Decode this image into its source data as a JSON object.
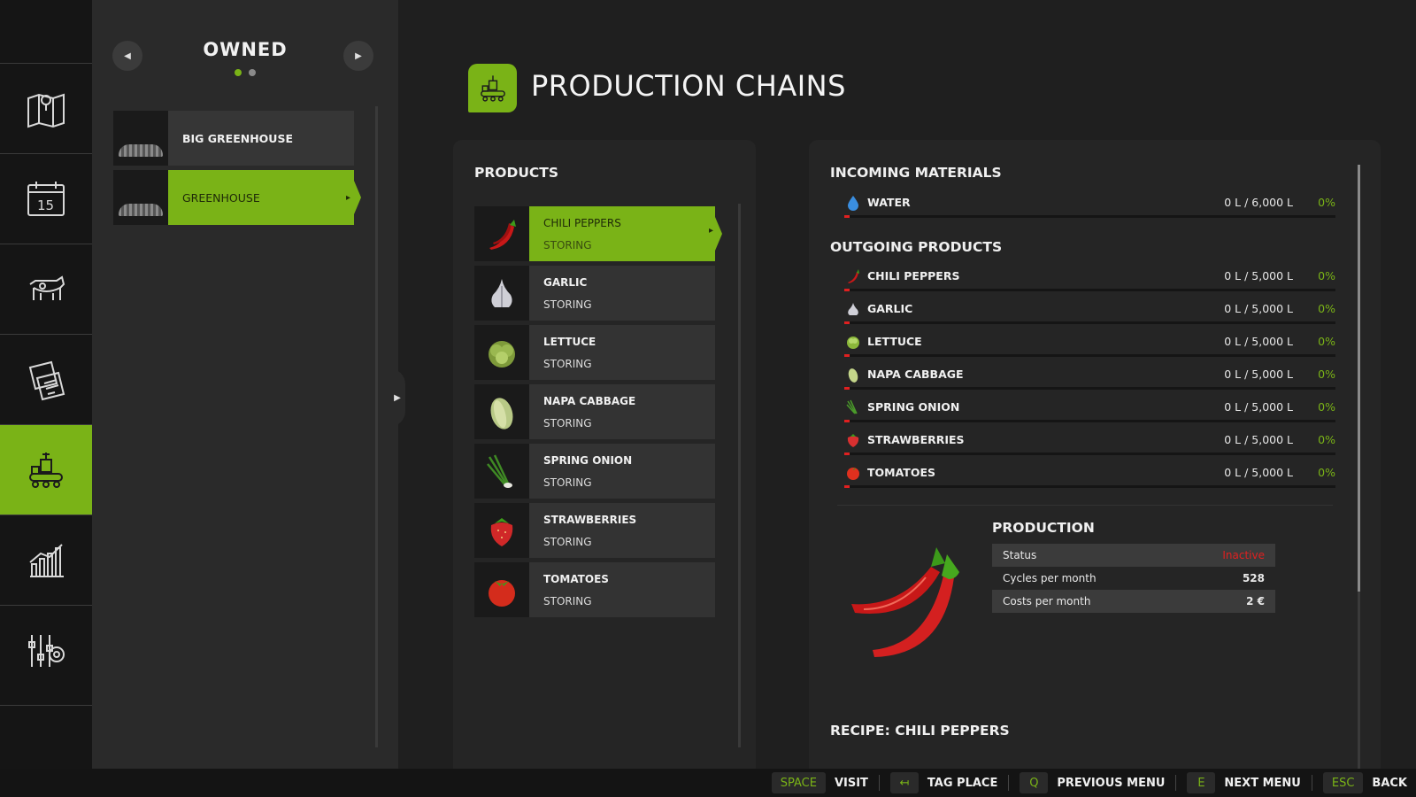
{
  "owned": {
    "title": "OWNED",
    "places": [
      {
        "label": "BIG GREENHOUSE"
      },
      {
        "label": "GREENHOUSE"
      }
    ]
  },
  "page": {
    "title": "PRODUCTION CHAINS"
  },
  "products": {
    "title": "PRODUCTS",
    "items": [
      {
        "name": "CHILI PEPPERS",
        "status": "STORING"
      },
      {
        "name": "GARLIC",
        "status": "STORING"
      },
      {
        "name": "LETTUCE",
        "status": "STORING"
      },
      {
        "name": "NAPA CABBAGE",
        "status": "STORING"
      },
      {
        "name": "SPRING ONION",
        "status": "STORING"
      },
      {
        "name": "STRAWBERRIES",
        "status": "STORING"
      },
      {
        "name": "TOMATOES",
        "status": "STORING"
      }
    ]
  },
  "details": {
    "incoming_title": "INCOMING MATERIALS",
    "incoming": [
      {
        "name": "WATER",
        "amount": "0 L / 6,000 L",
        "percent": "0%",
        "icon": "water-drop-icon"
      }
    ],
    "outgoing_title": "OUTGOING PRODUCTS",
    "outgoing": [
      {
        "name": "CHILI PEPPERS",
        "amount": "0 L / 5,000 L",
        "percent": "0%",
        "icon": "chili-icon"
      },
      {
        "name": "GARLIC",
        "amount": "0 L / 5,000 L",
        "percent": "0%",
        "icon": "garlic-icon"
      },
      {
        "name": "LETTUCE",
        "amount": "0 L / 5,000 L",
        "percent": "0%",
        "icon": "lettuce-icon"
      },
      {
        "name": "NAPA CABBAGE",
        "amount": "0 L / 5,000 L",
        "percent": "0%",
        "icon": "cabbage-icon"
      },
      {
        "name": "SPRING ONION",
        "amount": "0 L / 5,000 L",
        "percent": "0%",
        "icon": "spring-onion-icon"
      },
      {
        "name": "STRAWBERRIES",
        "amount": "0 L / 5,000 L",
        "percent": "0%",
        "icon": "strawberry-icon"
      },
      {
        "name": "TOMATOES",
        "amount": "0 L / 5,000 L",
        "percent": "0%",
        "icon": "tomato-icon"
      }
    ],
    "production": {
      "title": "PRODUCTION",
      "rows": [
        {
          "label": "Status",
          "value": "Inactive"
        },
        {
          "label": "Cycles per month",
          "value": "528"
        },
        {
          "label": "Costs per month",
          "value": "2 €"
        }
      ]
    },
    "recipe_title": "RECIPE: CHILI PEPPERS"
  },
  "hints": [
    {
      "key": "SPACE",
      "action": "VISIT"
    },
    {
      "key": "↤",
      "action": "TAG PLACE"
    },
    {
      "key": "Q",
      "action": "PREVIOUS MENU"
    },
    {
      "key": "E",
      "action": "NEXT MENU"
    },
    {
      "key": "ESC",
      "action": "BACK"
    }
  ],
  "colors": {
    "accent": "#7ab317",
    "alert": "#e02020",
    "panel": "#252525"
  }
}
